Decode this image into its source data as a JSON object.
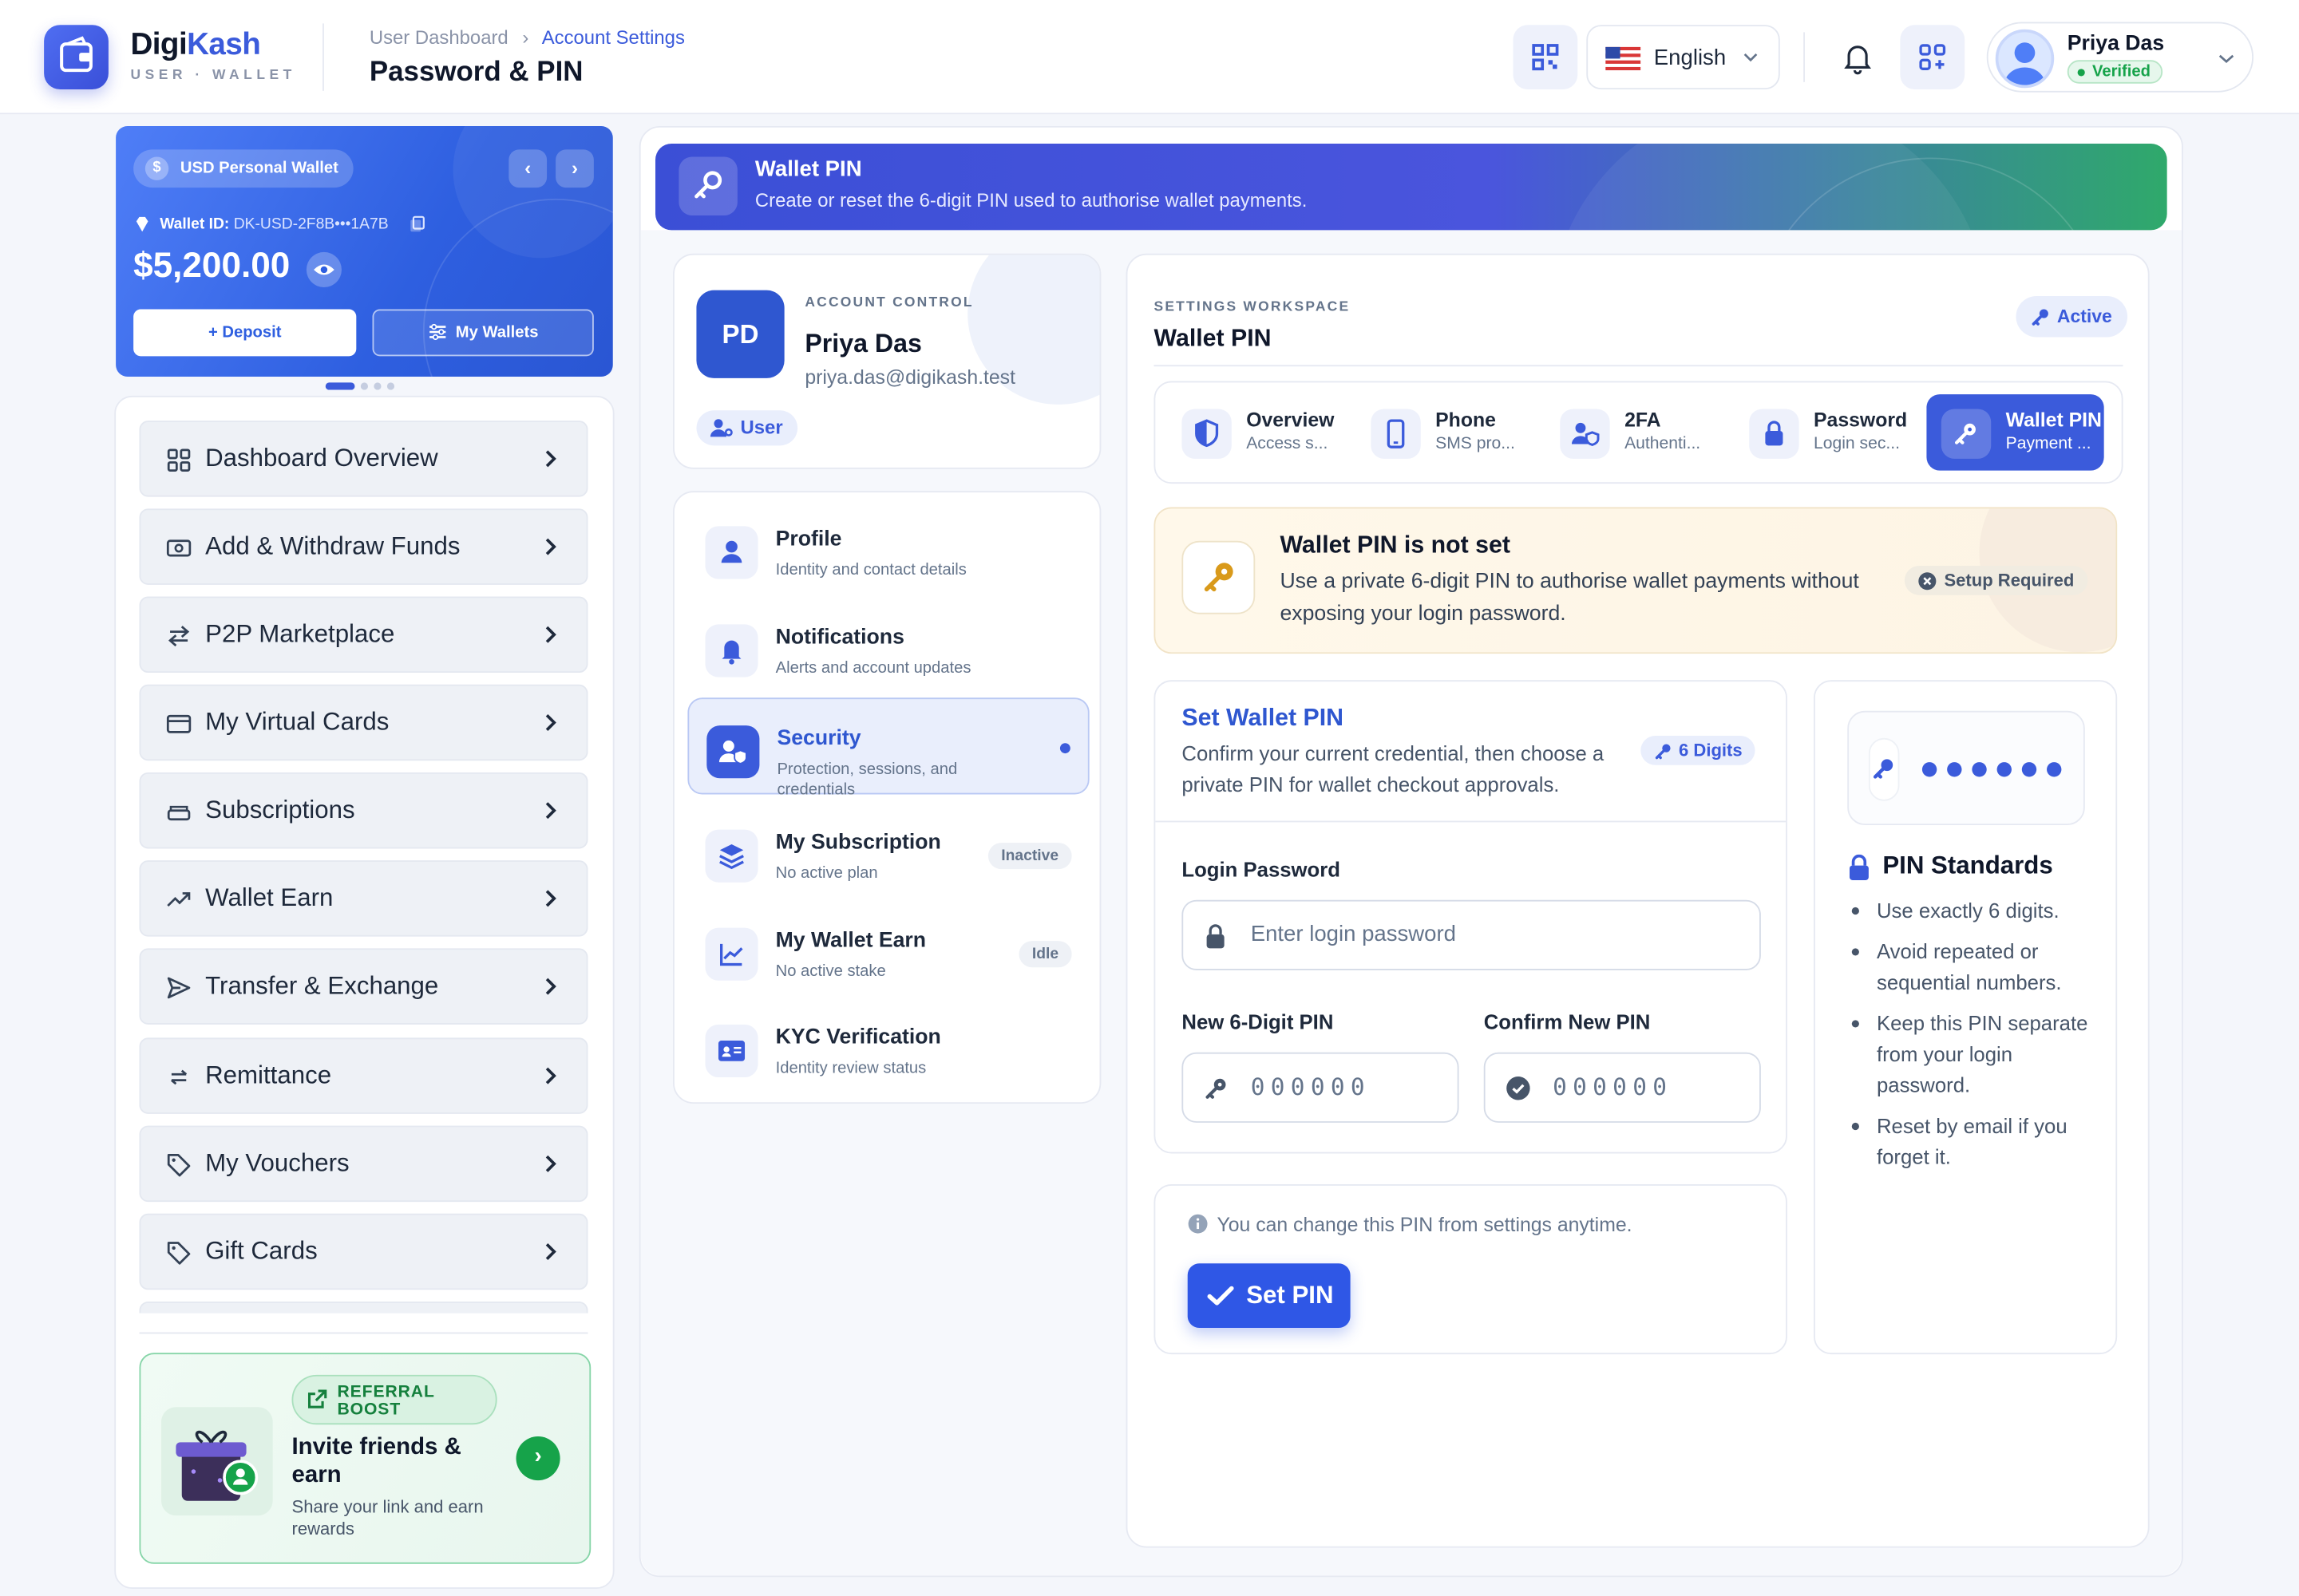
{
  "header": {
    "brand_prefix": "Digi",
    "brand_suffix": "Kash",
    "brand_sub": "USER · WALLET",
    "breadcrumb_root": "User Dashboard",
    "breadcrumb_sep": "›",
    "breadcrumb_current": "Account Settings",
    "page_title": "Password & PIN",
    "language": "English",
    "user_name": "Priya Das",
    "user_status": "Verified"
  },
  "wallet_card": {
    "wallet_name": "USD Personal Wallet",
    "currency_symbol": "$",
    "wallet_id_label": "Wallet ID:",
    "wallet_id": "DK-USD-2F8B•••1A7B",
    "balance": "$5,200.00",
    "deposit_label": "+ Deposit",
    "my_wallets_label": "My Wallets"
  },
  "sidebar": {
    "items": [
      {
        "label": "Dashboard Overview",
        "icon": "grid-icon"
      },
      {
        "label": "Add & Withdraw Funds",
        "icon": "cash-icon"
      },
      {
        "label": "P2P Marketplace",
        "icon": "swap-icon"
      },
      {
        "label": "My Virtual Cards",
        "icon": "card-icon"
      },
      {
        "label": "Subscriptions",
        "icon": "layers-icon"
      },
      {
        "label": "Wallet Earn",
        "icon": "trend-up-icon"
      },
      {
        "label": "Transfer & Exchange",
        "icon": "send-icon"
      },
      {
        "label": "Remittance",
        "icon": "exchange-icon"
      },
      {
        "label": "My Vouchers",
        "icon": "tag-icon"
      },
      {
        "label": "Gift Cards",
        "icon": "tag-icon"
      }
    ],
    "referral": {
      "badge": "REFERRAL BOOST",
      "title": "Invite friends & earn",
      "subtitle": "Share your link and earn rewards"
    }
  },
  "banner": {
    "title": "Wallet PIN",
    "subtitle": "Create or reset the 6-digit PIN used to authorise wallet payments."
  },
  "profile": {
    "initials": "PD",
    "kicker": "ACCOUNT CONTROL",
    "name": "Priya Das",
    "email": "priya.das@digikash.test",
    "role": "User"
  },
  "settings_menu": [
    {
      "title": "Profile",
      "subtitle": "Identity and contact details",
      "tag": ""
    },
    {
      "title": "Notifications",
      "subtitle": "Alerts and account updates",
      "tag": ""
    },
    {
      "title": "Security",
      "subtitle": "Protection, sessions, and credentials",
      "tag": ""
    },
    {
      "title": "My Subscription",
      "subtitle": "No active plan",
      "tag": "Inactive"
    },
    {
      "title": "My Wallet Earn",
      "subtitle": "No active stake",
      "tag": "Idle"
    },
    {
      "title": "KYC Verification",
      "subtitle": "Identity review status",
      "tag": ""
    }
  ],
  "workspace": {
    "kicker": "SETTINGS WORKSPACE",
    "title": "Wallet PIN",
    "status": "Active",
    "tabs": [
      {
        "title": "Overview",
        "subtitle": "Access s..."
      },
      {
        "title": "Phone",
        "subtitle": "SMS pro..."
      },
      {
        "title": "2FA",
        "subtitle": "Authenti..."
      },
      {
        "title": "Password",
        "subtitle": "Login sec..."
      },
      {
        "title": "Wallet PIN",
        "subtitle": "Payment ..."
      }
    ],
    "notice": {
      "title": "Wallet PIN is not set",
      "text": "Use a private 6-digit PIN to authorise wallet payments without exposing your login password.",
      "tag": "Setup Required"
    },
    "form": {
      "title": "Set Wallet PIN",
      "subtitle": "Confirm your current credential, then choose a private PIN for wallet checkout approvals.",
      "digits_badge": "6 Digits",
      "password_label": "Login Password",
      "password_placeholder": "Enter login password",
      "new_pin_label": "New 6-Digit PIN",
      "new_pin_placeholder": "000000",
      "confirm_pin_label": "Confirm New PIN",
      "confirm_pin_placeholder": "000000"
    },
    "action": {
      "hint": "You can change this PIN from settings anytime.",
      "button": "Set PIN"
    },
    "standards": {
      "title": "PIN Standards",
      "items": [
        "Use exactly 6 digits.",
        "Avoid repeated or sequential numbers.",
        "Keep this PIN separate from your login password.",
        "Reset by email if you forget it."
      ]
    }
  },
  "colors": {
    "primary": "#3b5bdb",
    "success": "#16a34a",
    "warning_bg": "#fff8ea",
    "banner_end": "#2fa96b"
  }
}
